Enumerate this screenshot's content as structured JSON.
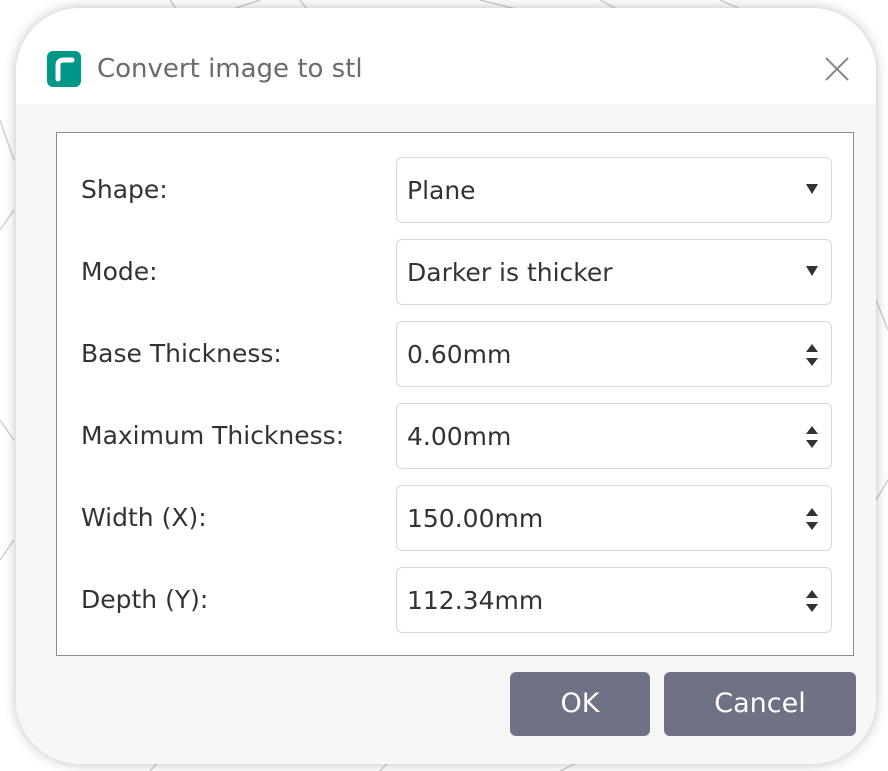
{
  "window": {
    "title": "Convert image to stl",
    "app_icon": "creality-print-icon",
    "close_icon": "close-icon"
  },
  "form": {
    "shape": {
      "label": "Shape:",
      "value": "Plane",
      "control": "dropdown"
    },
    "mode": {
      "label": "Mode:",
      "value": "Darker is thicker",
      "control": "dropdown"
    },
    "base_thickness": {
      "label": "Base Thickness:",
      "value": "0.60mm",
      "control": "spinbox"
    },
    "maximum_thickness": {
      "label": "Maximum Thickness:",
      "value": "4.00mm",
      "control": "spinbox"
    },
    "width": {
      "label": "Width (X):",
      "value": "150.00mm",
      "control": "spinbox"
    },
    "depth": {
      "label": "Depth (Y):",
      "value": "112.34mm",
      "control": "spinbox"
    }
  },
  "buttons": {
    "ok_label": "OK",
    "cancel_label": "Cancel"
  },
  "colors": {
    "accent_icon": "#009688",
    "button_bg": "#6f7284",
    "button_text": "#ffffff",
    "content_bg": "#f7f7f8"
  }
}
